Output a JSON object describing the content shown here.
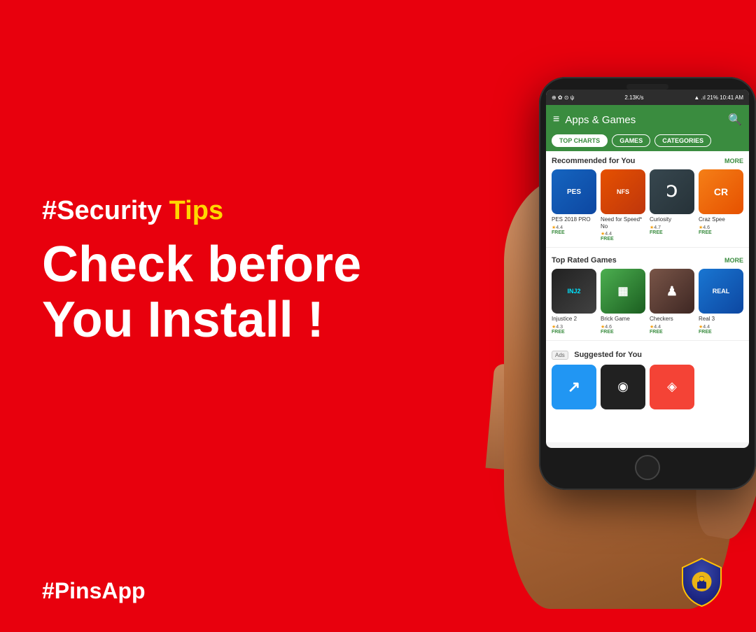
{
  "background": {
    "color": "#e8000d"
  },
  "left_content": {
    "hashtag_security": "#Security",
    "tips_word": "Tips",
    "headline_line1": "Check before",
    "headline_line2": "You Install !"
  },
  "bottom_left": {
    "label": "#PinsApp"
  },
  "phone": {
    "status_bar": {
      "left": "⊕ ✿ ⊙ ψ",
      "speed": "2.13K/s",
      "right": "▲ .ıl 21% 10:41 AM"
    },
    "header": {
      "title": "Apps & Games",
      "hamburger": "≡",
      "search": "🔍"
    },
    "tabs": [
      {
        "label": "TOP CHARTS",
        "active": true
      },
      {
        "label": "GAMES",
        "active": false
      },
      {
        "label": "CATEGORIES",
        "active": false
      }
    ],
    "sections": [
      {
        "id": "recommended",
        "title": "Recommended for You",
        "more": "MORE",
        "apps": [
          {
            "name": "PES 2018 PRO",
            "rating": "4.4",
            "price": "FREE",
            "color": "pes",
            "icon": "⚽"
          },
          {
            "name": "Need for Speed* No",
            "rating": "4.4",
            "price": "FREE",
            "color": "nfs",
            "icon": "🏎"
          },
          {
            "name": "Curiosity",
            "rating": "4.7",
            "price": "FREE",
            "color": "curiosity",
            "icon": "Ↄ"
          },
          {
            "name": "Craz Spee",
            "rating": "4.6",
            "price": "FREE",
            "color": "craz",
            "icon": "🚀"
          }
        ]
      },
      {
        "id": "top-rated",
        "title": "Top Rated Games",
        "more": "MORE",
        "apps": [
          {
            "name": "Injustice 2",
            "rating": "4.3",
            "price": "FREE",
            "color": "injustice",
            "icon": "⚡"
          },
          {
            "name": "Brick Game",
            "rating": "4.6",
            "price": "FREE",
            "color": "brick",
            "icon": "▦"
          },
          {
            "name": "Checkers",
            "rating": "4.4",
            "price": "FREE",
            "color": "chess",
            "icon": "♟"
          },
          {
            "name": "Real 3",
            "rating": "4.4",
            "price": "FREE",
            "color": "real3",
            "icon": "🏁"
          }
        ]
      }
    ],
    "ads_section": {
      "ads_label": "Ads",
      "title": "Suggested for You",
      "apps": [
        {
          "color": "suggested1",
          "icon": "↗"
        },
        {
          "color": "suggested2",
          "icon": "◉"
        },
        {
          "color": "suggested3",
          "icon": "◈"
        }
      ]
    }
  },
  "shield": {
    "color": "#1a237e",
    "accent": "#FFC107",
    "label": "PinsApp Shield"
  }
}
